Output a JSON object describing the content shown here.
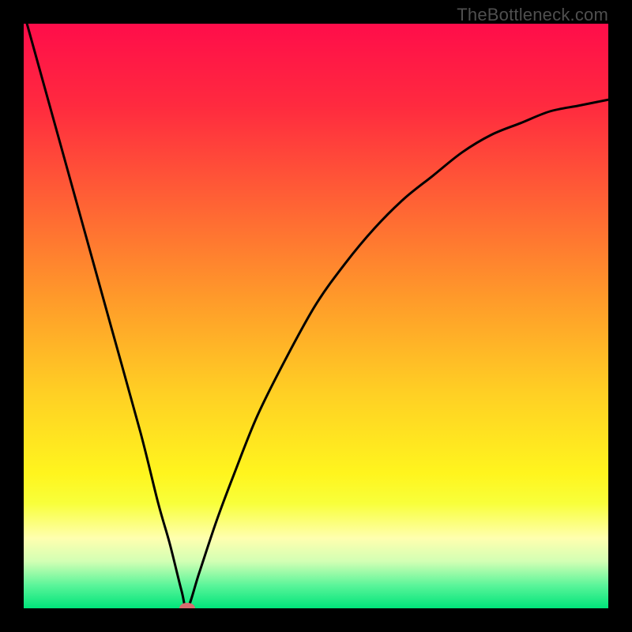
{
  "watermark": "TheBottleneck.com",
  "chart_data": {
    "type": "line",
    "title": "",
    "xlabel": "",
    "ylabel": "",
    "xlim": [
      0,
      100
    ],
    "ylim": [
      0,
      100
    ],
    "grid": false,
    "series": [
      {
        "name": "bottleneck-curve",
        "x": [
          0,
          5,
          10,
          15,
          20,
          23,
          25,
          27,
          28,
          30,
          33,
          36,
          40,
          45,
          50,
          55,
          60,
          65,
          70,
          75,
          80,
          85,
          90,
          95,
          100
        ],
        "values": [
          102,
          84,
          66,
          48,
          30,
          18,
          11,
          3,
          0,
          6,
          15,
          23,
          33,
          43,
          52,
          59,
          65,
          70,
          74,
          78,
          81,
          83,
          85,
          86,
          87
        ]
      }
    ],
    "minimum_marker": {
      "x": 28,
      "y": 0
    },
    "gradient_stops": [
      {
        "pos": 0.0,
        "color": "#ff0d4a"
      },
      {
        "pos": 0.14,
        "color": "#ff2a3f"
      },
      {
        "pos": 0.3,
        "color": "#ff6035"
      },
      {
        "pos": 0.47,
        "color": "#ff9a2a"
      },
      {
        "pos": 0.63,
        "color": "#ffcf24"
      },
      {
        "pos": 0.77,
        "color": "#fff51e"
      },
      {
        "pos": 0.82,
        "color": "#f8ff3a"
      },
      {
        "pos": 0.88,
        "color": "#ffffaf"
      },
      {
        "pos": 0.92,
        "color": "#d2ffb4"
      },
      {
        "pos": 0.96,
        "color": "#5cf59a"
      },
      {
        "pos": 1.0,
        "color": "#00e47a"
      }
    ]
  }
}
